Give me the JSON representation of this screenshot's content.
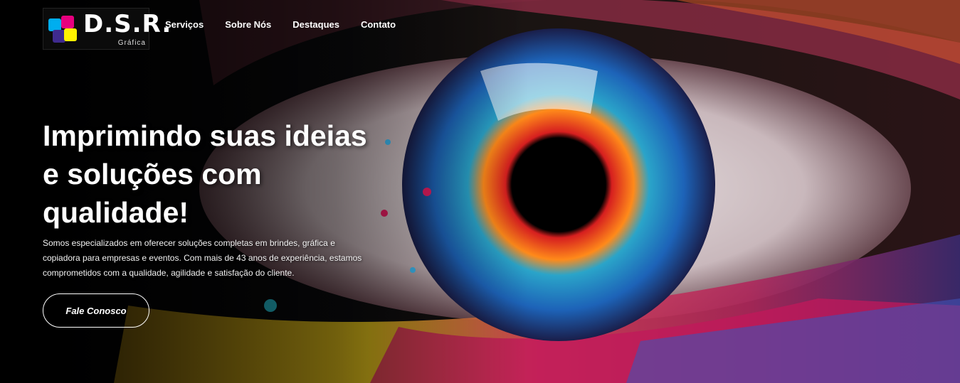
{
  "brand": {
    "name": "D.S.R.",
    "subtitle": "Gráfica",
    "colors": [
      "#e6007e",
      "#00aeef",
      "#fff200",
      "#3f2b8f"
    ]
  },
  "nav": {
    "items": [
      {
        "label": "Serviços"
      },
      {
        "label": "Sobre Nós"
      },
      {
        "label": "Destaques"
      },
      {
        "label": "Contato"
      }
    ]
  },
  "hero": {
    "headline": "Imprimindo suas ideias e soluções com qualidade!",
    "description": "Somos especializados em oferecer soluções completas em brindes, gráfica e copiadora para empresas e eventos. Com mais de 43 anos de experiência, estamos comprometidos com a qualidade, agilidade e satisfação do cliente.",
    "cta_label": "Fale Conosco",
    "background_image": "colorful-painted-eye-illustration"
  }
}
